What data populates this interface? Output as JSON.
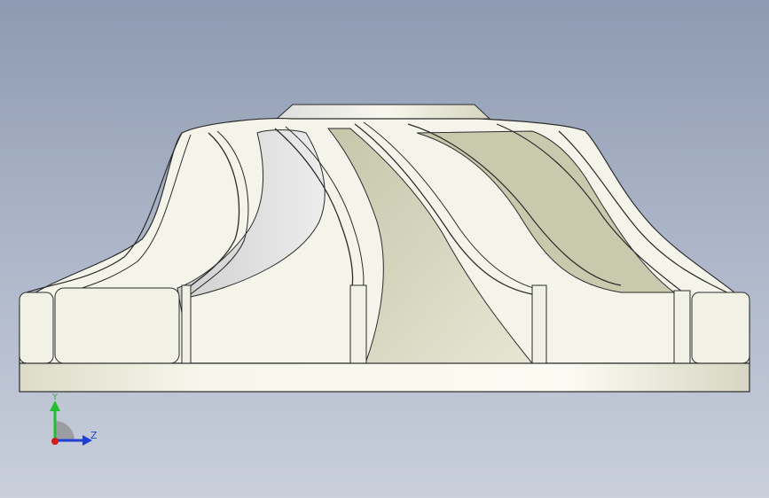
{
  "viewport": {
    "background_top": "#8d9ab1",
    "background_bottom": "#c9cfdb"
  },
  "model": {
    "name": "impeller",
    "surface_color": "#f2f2e8",
    "shade_color": "#b9b99c",
    "edge_color": "#2b2b2b"
  },
  "triad": {
    "y_label": "Y",
    "z_label": "Z",
    "y_color": "#1fbf2f",
    "z_color": "#1f3fd6",
    "x_color": "#d11a1a"
  }
}
